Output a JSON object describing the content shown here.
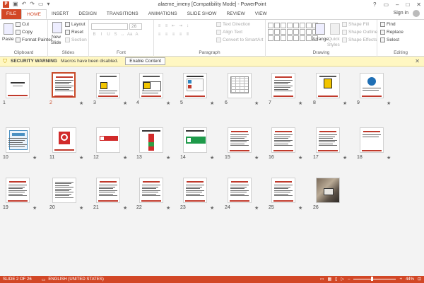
{
  "app": {
    "title": "alaeme_imeny [Compatibility Mode] - PowerPoint",
    "logo_letter": "P",
    "signin": "Sign in"
  },
  "tabs": [
    "FILE",
    "HOME",
    "INSERT",
    "DESIGN",
    "TRANSITIONS",
    "ANIMATIONS",
    "SLIDE SHOW",
    "REVIEW",
    "VIEW"
  ],
  "ribbon": {
    "clipboard": {
      "paste": "Paste",
      "cut": "Cut",
      "copy": "Copy",
      "format_painter": "Format Painter",
      "label": "Clipboard"
    },
    "slides": {
      "new_slide": "New",
      "new_slide2": "Slide",
      "layout": "Layout",
      "reset": "Reset",
      "section": "Section",
      "label": "Slides"
    },
    "font": {
      "size": "26",
      "label": "Font"
    },
    "paragraph": {
      "text_direction": "Text Direction",
      "align_text": "Align Text",
      "convert": "Convert to SmartArt",
      "label": "Paragraph"
    },
    "drawing": {
      "arrange": "Arrange",
      "quick_styles": "Quick",
      "quick_styles2": "Styles",
      "shape_fill": "Shape Fill",
      "shape_outline": "Shape Outline",
      "shape_effects": "Shape Effects",
      "label": "Drawing"
    },
    "editing": {
      "find": "Find",
      "replace": "Replace",
      "select": "Select",
      "label": "Editing"
    }
  },
  "security": {
    "title": "SECURITY WARNING",
    "message": "Macros have been disabled.",
    "button": "Enable Content"
  },
  "slides": [
    {
      "num": "1",
      "star": false,
      "kind": "title"
    },
    {
      "num": "2",
      "star": true,
      "kind": "text",
      "selected": true
    },
    {
      "num": "3",
      "star": true,
      "kind": "warn"
    },
    {
      "num": "4",
      "star": true,
      "kind": "warn2"
    },
    {
      "num": "5",
      "star": true,
      "kind": "table"
    },
    {
      "num": "6",
      "star": true,
      "kind": "grid"
    },
    {
      "num": "7",
      "star": true,
      "kind": "text"
    },
    {
      "num": "8",
      "star": true,
      "kind": "warnbig"
    },
    {
      "num": "9",
      "star": true,
      "kind": "blue"
    },
    {
      "num": "10",
      "star": true,
      "kind": "poster"
    },
    {
      "num": "11",
      "star": true,
      "kind": "nofire"
    },
    {
      "num": "12",
      "star": true,
      "kind": "redbar"
    },
    {
      "num": "13",
      "star": true,
      "kind": "signs"
    },
    {
      "num": "14",
      "star": true,
      "kind": "exit"
    },
    {
      "num": "15",
      "star": true,
      "kind": "text"
    },
    {
      "num": "16",
      "star": true,
      "kind": "text"
    },
    {
      "num": "17",
      "star": true,
      "kind": "text"
    },
    {
      "num": "18",
      "star": true,
      "kind": "short"
    },
    {
      "num": "19",
      "star": true,
      "kind": "text"
    },
    {
      "num": "20",
      "star": true,
      "kind": "lines"
    },
    {
      "num": "21",
      "star": true,
      "kind": "text"
    },
    {
      "num": "22",
      "star": true,
      "kind": "text"
    },
    {
      "num": "23",
      "star": true,
      "kind": "text"
    },
    {
      "num": "24",
      "star": true,
      "kind": "text"
    },
    {
      "num": "25",
      "star": true,
      "kind": "text"
    },
    {
      "num": "26",
      "star": false,
      "kind": "photo"
    }
  ],
  "status": {
    "slide": "SLIDE 2 OF 26",
    "language": "ENGLISH (UNITED STATES)",
    "zoom": "44%",
    "zoom_level": 0.44
  },
  "colors": {
    "accent": "#d24726",
    "warning_bg": "#fff7c2",
    "slide_rule": "#c0392b"
  }
}
